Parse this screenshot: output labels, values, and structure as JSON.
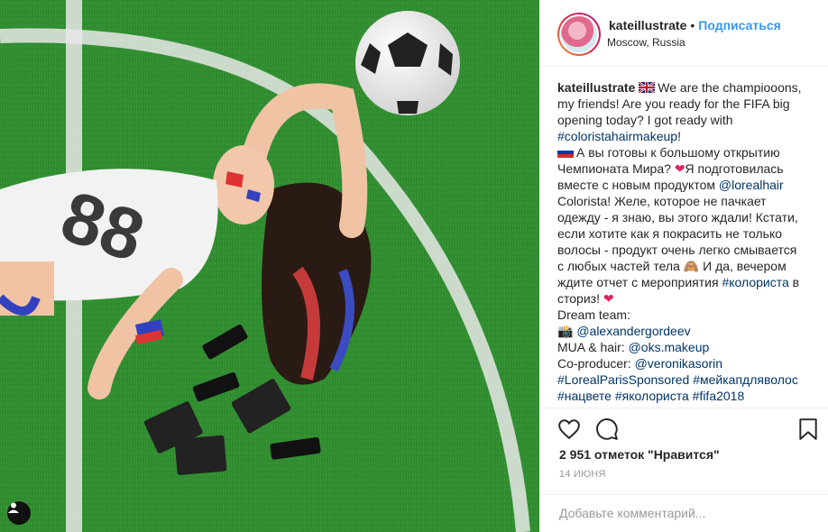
{
  "photo": {
    "alt": "",
    "colors": {
      "grass": "#2f8a2f",
      "lines": "#e6e6e6"
    }
  },
  "header": {
    "username": "kateillustrate",
    "separator": "•",
    "follow_label": "Подписаться",
    "location": "Moscow, Russia"
  },
  "caption": {
    "username": "kateillustrate",
    "l1": "We are the champiooons,",
    "l2": "my friends! Are you ready for the FIFA big",
    "l3": "opening today? I got ready with",
    "l4_tag": "#coloristahairmakeup",
    "l4_rest": "!",
    "l5": "А вы готовы к большому открытию",
    "l6": "Чемпионата Мира?",
    "l6_rest": "Я подготовилась",
    "l7": "вместе с новым продуктом",
    "l7_mention": "@lorealhair",
    "l8": "Colorista! Желе, которое не пачкает",
    "l9": "одежду - я знаю, вы этого ждали! Кстати,",
    "l10": "если хотите как я покрасить не только",
    "l11": "волосы - продукт очень легко смывается",
    "l12": "с любых частей тела",
    "l12_rest": "И да, вечером",
    "l13": "ждите отчет с мероприятия",
    "l13_tag": "#колориста",
    "l13_rest": "в",
    "l14": "сториз!",
    "l15": "Dream team:",
    "l16_mention": "@alexandergordeev",
    "l17": "MUA & hair:",
    "l17_mention": "@oks.makeup",
    "l18": "Co-producer:",
    "l18_mention": "@veronikasorin",
    "l19_tag1": "#LorealParisSponsored",
    "l19_tag2": "#мейкапдляволос",
    "l20_tag1": "#нацвете",
    "l20_tag2": "#яколориста",
    "l20_tag3": "#fifa2018"
  },
  "stats": {
    "likes": "2 951 отметок \"Нравится\"",
    "date": "14 ИЮНЯ"
  },
  "comment": {
    "placeholder": "Добавьте комментарий..."
  },
  "icons": {
    "like": "heart-icon",
    "comment": "comment-icon",
    "save": "bookmark-icon",
    "user_tag": "user-icon"
  }
}
